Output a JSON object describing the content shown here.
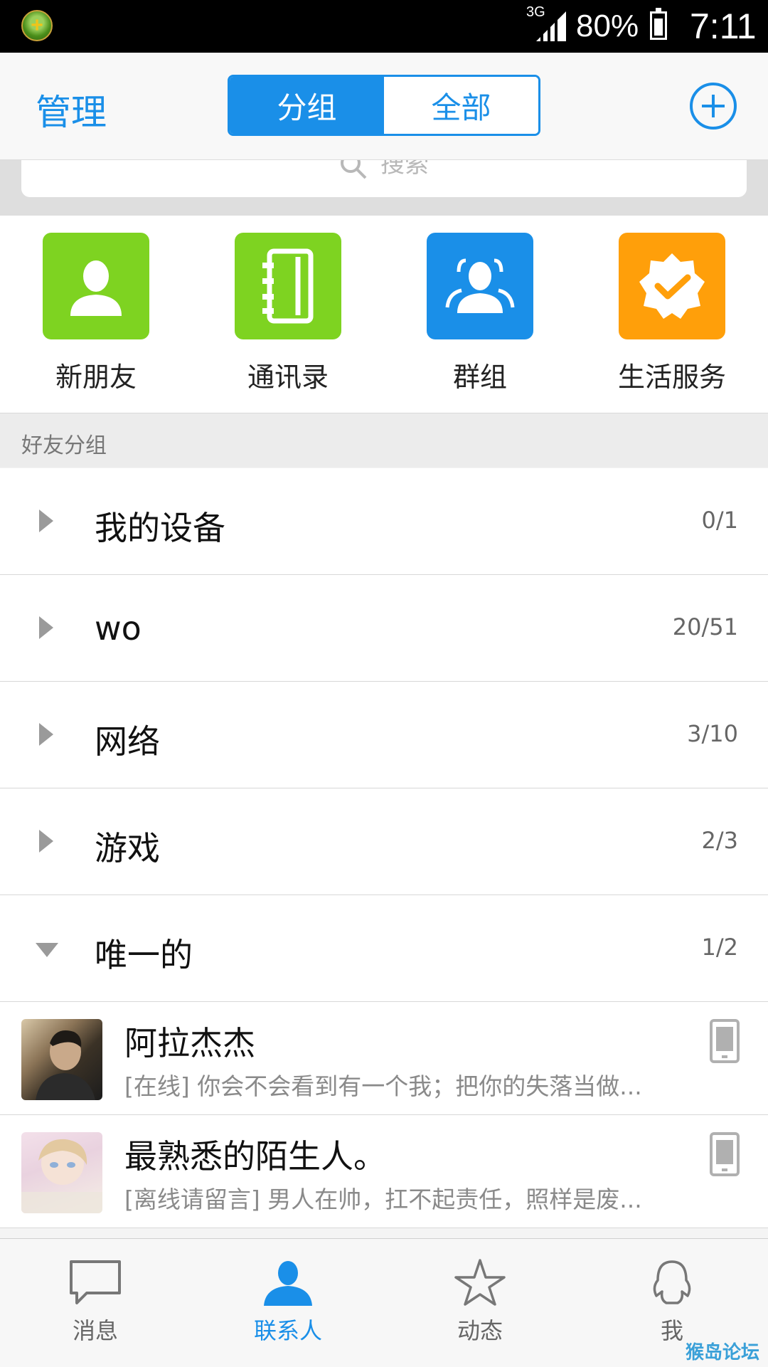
{
  "status_bar": {
    "network": "3G",
    "battery": "80%",
    "time": "7:11"
  },
  "header": {
    "manage": "管理",
    "tabs": [
      {
        "label": "分组",
        "active": true
      },
      {
        "label": "全部",
        "active": false
      }
    ]
  },
  "search": {
    "placeholder": "搜索"
  },
  "quick_actions": [
    {
      "label": "新朋友",
      "icon": "person-icon",
      "color": "#7ed321"
    },
    {
      "label": "通讯录",
      "icon": "address-book-icon",
      "color": "#7ed321"
    },
    {
      "label": "群组",
      "icon": "group-icon",
      "color": "#1a8fe8"
    },
    {
      "label": "生活服务",
      "icon": "badge-check-icon",
      "color": "#ff9f0a"
    }
  ],
  "section_header": "好友分组",
  "groups": [
    {
      "name": "我的设备",
      "count": "0/1",
      "expanded": false
    },
    {
      "name": "wo",
      "count": "20/51",
      "expanded": false
    },
    {
      "name": "网络",
      "count": "3/10",
      "expanded": false
    },
    {
      "name": "游戏",
      "count": "2/3",
      "expanded": false
    },
    {
      "name": "唯一的",
      "count": "1/2",
      "expanded": true
    }
  ],
  "friends": [
    {
      "name": "阿拉杰杰",
      "status": "[在线] 你会不会看到有一个我；把你的失落当做...",
      "device": "phone-icon"
    },
    {
      "name": "最熟悉的陌生人。",
      "status": "[离线请留言] 男人在帅，扛不起责任，照样是废...",
      "device": "phone-icon"
    }
  ],
  "tabbar": [
    {
      "label": "消息",
      "icon": "message-icon",
      "active": false
    },
    {
      "label": "联系人",
      "icon": "contacts-icon",
      "active": true
    },
    {
      "label": "动态",
      "icon": "star-icon",
      "active": false
    },
    {
      "label": "我",
      "icon": "penguin-icon",
      "active": false
    }
  ],
  "watermark": "猴岛论坛",
  "colors": {
    "accent": "#1a8fe8",
    "green": "#7ed321",
    "orange": "#ff9f0a"
  }
}
